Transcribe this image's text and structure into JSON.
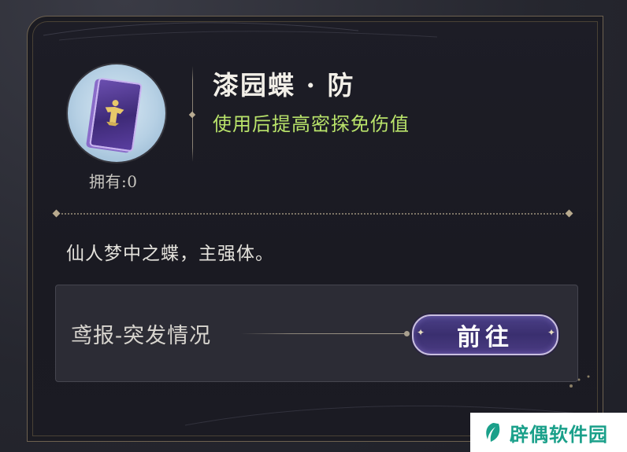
{
  "item": {
    "name": "漆园蝶 · 防",
    "effect": "使用后提高密探免伤值",
    "owned_label": "拥有:0",
    "description": "仙人梦中之蝶，主强体。"
  },
  "source": {
    "label": "鸢报-突发情况",
    "goto_label": "前往"
  },
  "watermark": {
    "text": "辟偶软件园"
  },
  "colors": {
    "effect_text": "#b9e36a",
    "button_bg": "#3a2f6f"
  }
}
